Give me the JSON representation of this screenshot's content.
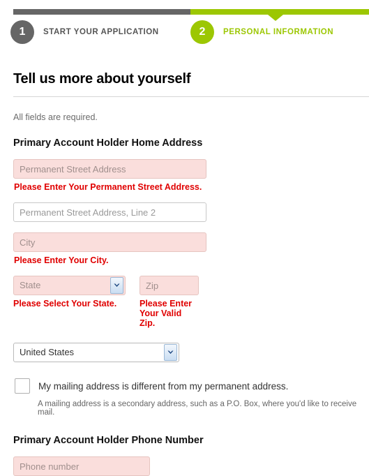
{
  "stepper": {
    "colors": {
      "done": "#666666",
      "active": "#9cc703"
    },
    "steps": [
      {
        "number": "1",
        "label": "START YOUR APPLICATION",
        "state": "done"
      },
      {
        "number": "2",
        "label": "PERSONAL INFORMATION",
        "state": "active"
      }
    ]
  },
  "page": {
    "title": "Tell us more about yourself",
    "required_note": "All fields are required."
  },
  "address_section": {
    "title": "Primary Account Holder Home Address",
    "street1": {
      "placeholder": "Permanent Street Address",
      "value": "",
      "error": "Please Enter Your Permanent Street Address."
    },
    "street2": {
      "placeholder": "Permanent Street Address, Line 2",
      "value": ""
    },
    "city": {
      "placeholder": "City",
      "value": "",
      "error": "Please Enter Your City."
    },
    "state": {
      "placeholder": "State",
      "selected": "State",
      "error": "Please Select Your State."
    },
    "zip": {
      "placeholder": "Zip",
      "value": "",
      "error": "Please Enter Your Valid Zip."
    },
    "country": {
      "selected": "United States"
    },
    "mailing_checkbox": {
      "label": "My mailing address is different from my permanent address.",
      "help": "A mailing address is a secondary address, such as a P.O. Box, where you'd like to receive mail.",
      "checked": false
    }
  },
  "phone_section": {
    "title": "Primary Account Holder Phone Number",
    "phone": {
      "placeholder": "Phone number",
      "value": ""
    }
  }
}
